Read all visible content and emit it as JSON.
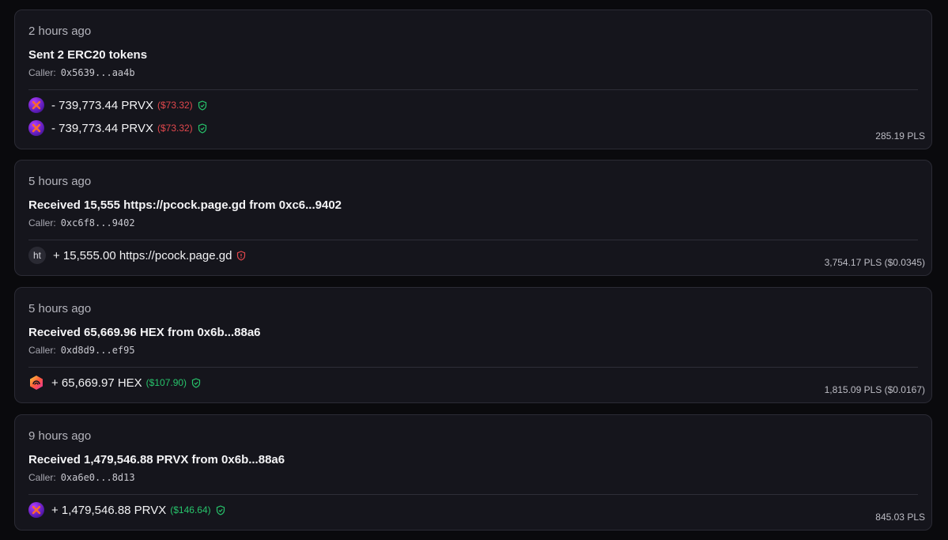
{
  "transactions": [
    {
      "time": "2 hours ago",
      "title": "Sent 2 ERC20 tokens",
      "caller_label": "Caller:",
      "caller": "0x5639...aa4b",
      "transfers": [
        {
          "token_icon": "prvx-token-icon",
          "amount": "- 739,773.44 PRVX",
          "usd": "($73.32)",
          "usd_color": "#e0474c",
          "shield": "verified-shield-icon"
        },
        {
          "token_icon": "prvx-token-icon",
          "amount": "- 739,773.44 PRVX",
          "usd": "($73.32)",
          "usd_color": "#e0474c",
          "shield": "verified-shield-icon"
        }
      ],
      "fee": "285.19 PLS"
    },
    {
      "time": "5 hours ago",
      "title": "Received 15,555 https://pcock.page.gd from 0xc6...9402",
      "caller_label": "Caller:",
      "caller": "0xc6f8...9402",
      "transfers": [
        {
          "token_icon": "ht-token-icon",
          "token_text": "ht",
          "amount": "+ 15,555.00 https://pcock.page.gd",
          "usd": "",
          "shield": "warning-shield-icon"
        }
      ],
      "fee": "3,754.17 PLS ($0.0345)"
    },
    {
      "time": "5 hours ago",
      "title": "Received 65,669.96 HEX from 0x6b...88a6",
      "caller_label": "Caller:",
      "caller": "0xd8d9...ef95",
      "transfers": [
        {
          "token_icon": "hex-token-icon",
          "amount": "+ 65,669.97 HEX",
          "usd": "($107.90)",
          "usd_color": "#27c46b",
          "shield": "verified-shield-icon"
        }
      ],
      "fee": "1,815.09 PLS ($0.0167)"
    },
    {
      "time": "9 hours ago",
      "title": "Received 1,479,546.88 PRVX from 0x6b...88a6",
      "caller_label": "Caller:",
      "caller": "0xa6e0...8d13",
      "transfers": [
        {
          "token_icon": "prvx-token-icon",
          "amount": "+ 1,479,546.88 PRVX",
          "usd": "($146.64)",
          "usd_color": "#27c46b",
          "shield": "verified-shield-icon"
        }
      ],
      "fee": "845.03 PLS"
    }
  ]
}
